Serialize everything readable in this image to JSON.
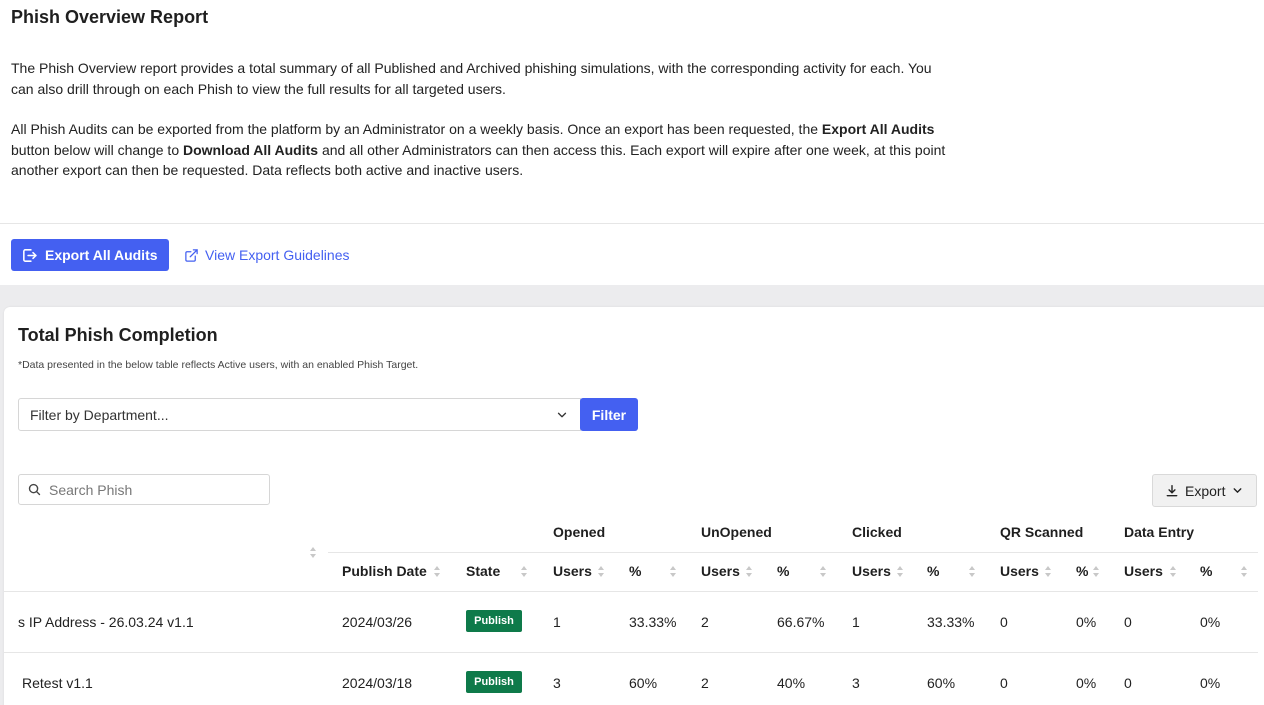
{
  "page": {
    "title": "Phish Overview Report",
    "intro_1": "The Phish Overview report provides a total summary of all Published and Archived phishing simulations, with the corresponding activity for each. You can also drill through on each Phish to view the full results for all targeted users.",
    "intro_2_a": "All Phish Audits can be exported from the platform by an Administrator on a weekly basis. Once an export has been requested, the ",
    "intro_2_b": "Export All Audits",
    "intro_2_c": " button below will change to ",
    "intro_2_d": "Download All Audits",
    "intro_2_e": " and all other Administrators can then access this. Each export will expire after one week, at this point another export can then be requested. Data reflects both active and inactive users."
  },
  "actions": {
    "export_all_label": "Export All Audits",
    "guidelines_label": "View Export Guidelines"
  },
  "card": {
    "title": "Total Phish Completion",
    "note": "*Data presented in the below table reflects Active users, with an enabled Phish Target.",
    "department_placeholder": "Filter by Department...",
    "filter_label": "Filter",
    "search_placeholder": "Search Phish",
    "export_label": "Export"
  },
  "table": {
    "groups": [
      "Opened",
      "UnOpened",
      "Clicked",
      "QR Scanned",
      "Data Entry"
    ],
    "columns": {
      "publish_date": "Publish Date",
      "state": "State",
      "users": "Users",
      "pct": "%"
    },
    "rows": [
      {
        "name": "s IP Address - 26.03.24 v1.1",
        "date": "2024/03/26",
        "state": "Publish",
        "opened_users": "1",
        "opened_pct": "33.33%",
        "unopened_users": "2",
        "unopened_pct": "66.67%",
        "clicked_users": "1",
        "clicked_pct": "33.33%",
        "qr_users": "0",
        "qr_pct": "0%",
        "data_users": "0",
        "data_pct": "0%"
      },
      {
        "name": "Retest v1.1",
        "date": "2024/03/18",
        "state": "Publish",
        "opened_users": "3",
        "opened_pct": "60%",
        "unopened_users": "2",
        "unopened_pct": "40%",
        "clicked_users": "3",
        "clicked_pct": "60%",
        "qr_users": "0",
        "qr_pct": "0%",
        "data_users": "0",
        "data_pct": "0%"
      }
    ]
  },
  "colors": {
    "primary": "#4460f1",
    "publish_badge": "#0e7a4a",
    "band": "#ececee"
  }
}
